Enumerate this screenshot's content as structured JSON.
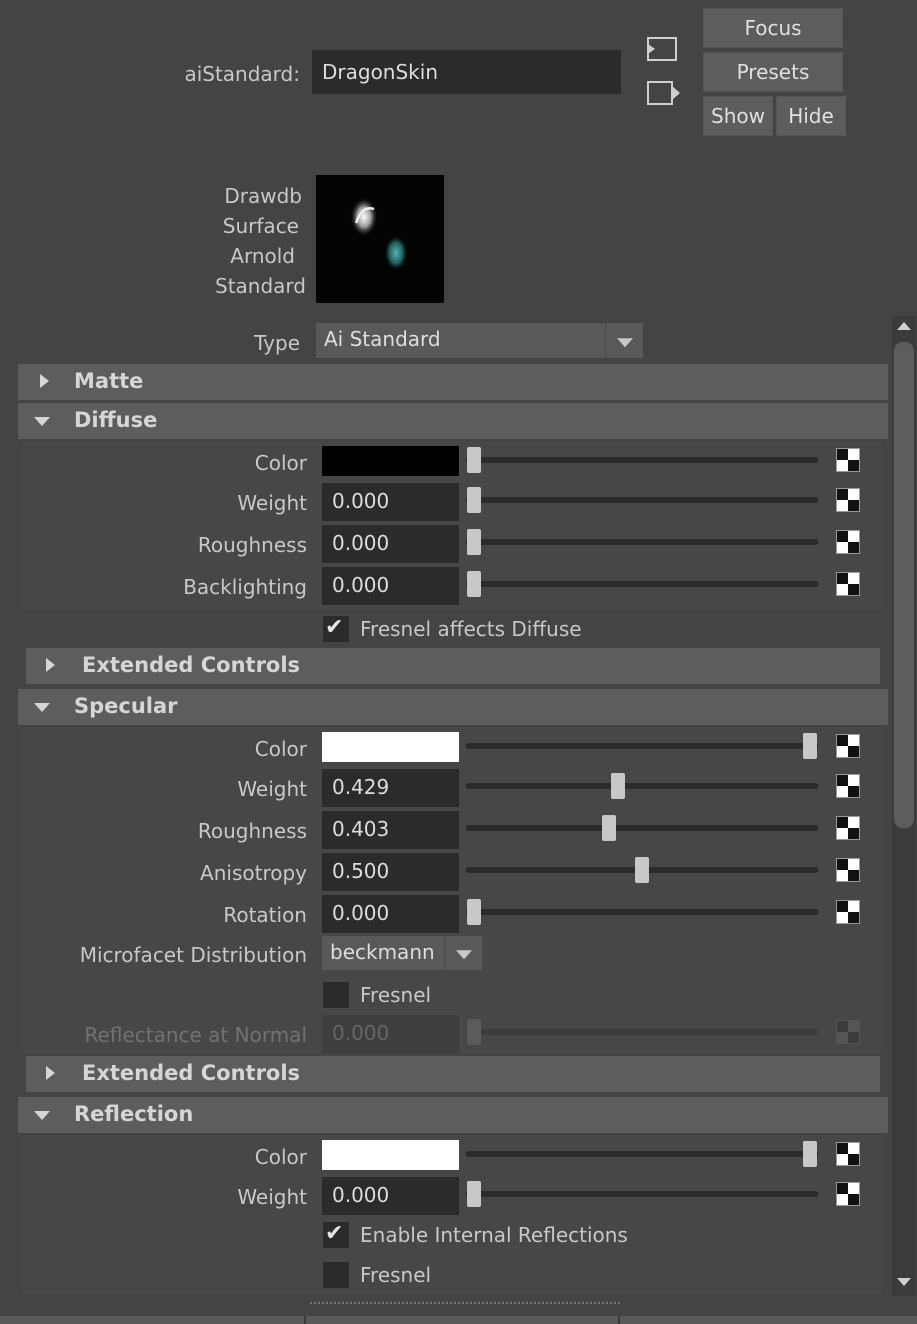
{
  "header": {
    "node_type_label": "aiStandard:",
    "node_name": "DragonSkin",
    "focus_label": "Focus",
    "presets_label": "Presets",
    "show_label": "Show",
    "hide_label": "Hide"
  },
  "swatch_caption": [
    "Drawdb",
    "Surface",
    "Arnold",
    "Standard"
  ],
  "type_row": {
    "label": "Type",
    "value": "Ai Standard"
  },
  "sections": {
    "matte": "Matte",
    "diffuse": "Diffuse",
    "diffuse_extended": "Extended Controls",
    "specular": "Specular",
    "specular_extended": "Extended Controls",
    "reflection": "Reflection"
  },
  "diffuse": {
    "color_label": "Color",
    "color_value": "#000000",
    "color_slider": 0.0,
    "weight_label": "Weight",
    "weight": "0.000",
    "weight_slider": 0.0,
    "roughness_label": "Roughness",
    "roughness": "0.000",
    "roughness_slider": 0.0,
    "backlighting_label": "Backlighting",
    "backlighting": "0.000",
    "backlighting_slider": 0.0,
    "fresnel_affects_label": "Fresnel affects Diffuse",
    "fresnel_affects_checked": true
  },
  "specular": {
    "color_label": "Color",
    "color_value": "#ffffff",
    "color_slider": 1.0,
    "weight_label": "Weight",
    "weight": "0.429",
    "weight_slider": 0.429,
    "roughness_label": "Roughness",
    "roughness": "0.403",
    "roughness_slider": 0.403,
    "anisotropy_label": "Anisotropy",
    "anisotropy": "0.500",
    "anisotropy_slider": 0.5,
    "rotation_label": "Rotation",
    "rotation": "0.000",
    "rotation_slider": 0.0,
    "microfacet_label": "Microfacet Distribution",
    "microfacet_value": "beckmann",
    "fresnel_label": "Fresnel",
    "fresnel_checked": false,
    "reflectance_label": "Reflectance at Normal",
    "reflectance": "0.000",
    "reflectance_slider": 0.0
  },
  "reflection": {
    "color_label": "Color",
    "color_value": "#ffffff",
    "color_slider": 1.0,
    "weight_label": "Weight",
    "weight": "0.000",
    "weight_slider": 0.0,
    "internal_label": "Enable Internal Reflections",
    "internal_checked": true,
    "fresnel_label": "Fresnel",
    "fresnel_checked": false
  },
  "icons": {
    "copy_tab": "copy-tab-icon",
    "select_node": "select-node-icon",
    "map": "checker-map-icon",
    "check": "checkmark-icon"
  }
}
